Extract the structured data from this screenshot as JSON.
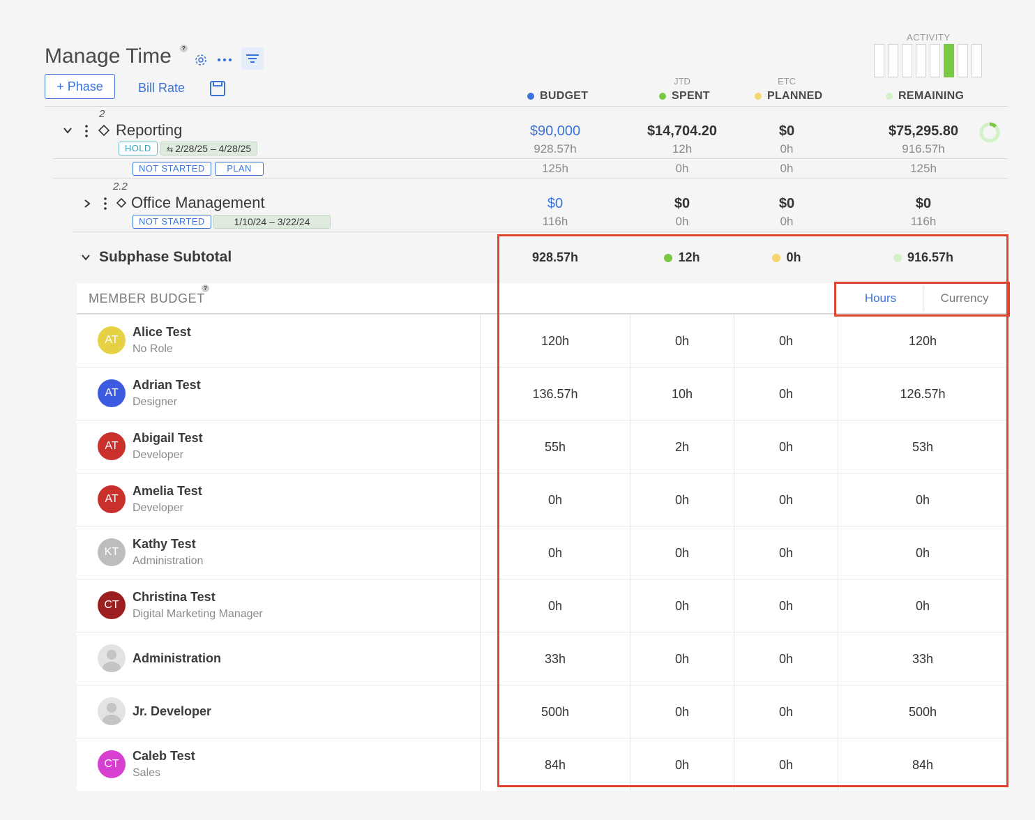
{
  "page": {
    "title": "Manage Time",
    "phase_button": "+ Phase",
    "bill_rate": "Bill Rate",
    "activity_label": "ACTIVITY",
    "activity_level": 0.7
  },
  "columns": {
    "budget": "BUDGET",
    "jtd": "JTD",
    "spent": "SPENT",
    "etc": "ETC",
    "planned": "PLANNED",
    "remaining": "REMAINING"
  },
  "colors": {
    "budget": "#3b73d9",
    "spent": "#7ac943",
    "planned": "#f5d76e",
    "remaining": "#d4f0c6",
    "accent": "#3b73d9",
    "highlight": "#e0432e"
  },
  "phase": {
    "number": "2",
    "name": "Reporting",
    "status": "HOLD",
    "dates": "2/28/25  –  4/28/25",
    "budget": "$90,000",
    "budget_hours": "928.57h",
    "spent": "$14,704.20",
    "spent_hours": "12h",
    "planned": "$0",
    "planned_hours": "0h",
    "remaining": "$75,295.80",
    "remaining_hours": "916.57h",
    "tag1": "NOT STARTED",
    "tag2": "PLAN",
    "row2_budget": "125h",
    "row2_spent": "0h",
    "row2_planned": "0h",
    "row2_remaining": "125h"
  },
  "subphase": {
    "number": "2.2",
    "name": "Office Management",
    "status": "NOT STARTED",
    "dates": "1/10/24  –  3/22/24",
    "budget": "$0",
    "budget_hours": "116h",
    "spent": "$0",
    "spent_hours": "0h",
    "planned": "$0",
    "planned_hours": "0h",
    "remaining": "$0",
    "remaining_hours": "116h"
  },
  "subtotal": {
    "label": "Subphase Subtotal",
    "budget": "928.57h",
    "spent": "12h",
    "planned": "0h",
    "remaining": "916.57h"
  },
  "member_budget": {
    "header": "MEMBER BUDGET",
    "toggle_hours": "Hours",
    "toggle_currency": "Currency",
    "members": [
      {
        "initials": "AT",
        "name": "Alice Test",
        "role": "No Role",
        "color": "#e6d043",
        "budget": "120h",
        "spent": "0h",
        "planned": "0h",
        "remaining": "120h"
      },
      {
        "initials": "AT",
        "name": "Adrian Test",
        "role": "Designer",
        "color": "#3d5be0",
        "budget": "136.57h",
        "spent": "10h",
        "planned": "0h",
        "remaining": "126.57h"
      },
      {
        "initials": "AT",
        "name": "Abigail Test",
        "role": "Developer",
        "color": "#c9302c",
        "budget": "55h",
        "spent": "2h",
        "planned": "0h",
        "remaining": "53h"
      },
      {
        "initials": "AT",
        "name": "Amelia Test",
        "role": "Developer",
        "color": "#c9302c",
        "budget": "0h",
        "spent": "0h",
        "planned": "0h",
        "remaining": "0h"
      },
      {
        "initials": "KT",
        "name": "Kathy Test",
        "role": "Administration",
        "color": "#bdbdbd",
        "budget": "0h",
        "spent": "0h",
        "planned": "0h",
        "remaining": "0h"
      },
      {
        "initials": "CT",
        "name": "Christina Test",
        "role": "Digital Marketing Manager",
        "color": "#9c1f1f",
        "budget": "0h",
        "spent": "0h",
        "planned": "0h",
        "remaining": "0h"
      },
      {
        "initials": "",
        "name": "Administration",
        "role": "",
        "color": "",
        "budget": "33h",
        "spent": "0h",
        "planned": "0h",
        "remaining": "33h"
      },
      {
        "initials": "",
        "name": "Jr. Developer",
        "role": "",
        "color": "",
        "budget": "500h",
        "spent": "0h",
        "planned": "0h",
        "remaining": "500h"
      },
      {
        "initials": "CT",
        "name": "Caleb Test",
        "role": "Sales",
        "color": "#d63fcf",
        "budget": "84h",
        "spent": "0h",
        "planned": "0h",
        "remaining": "84h"
      }
    ]
  }
}
